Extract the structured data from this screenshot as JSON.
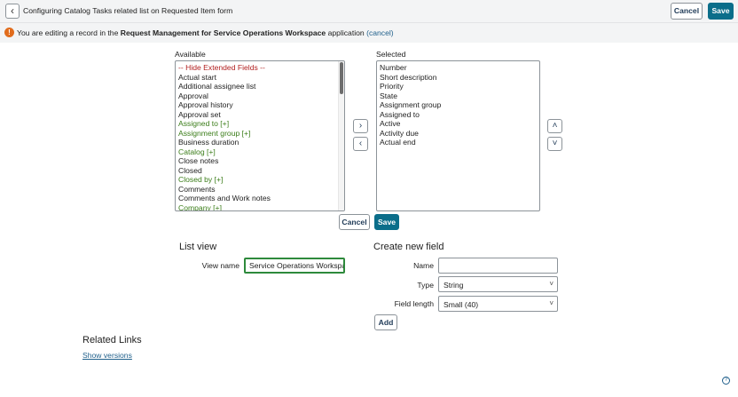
{
  "header": {
    "back_icon": "chevron-left-icon",
    "title": "Configuring Catalog Tasks related list on Requested Item form",
    "cancel_label": "Cancel",
    "save_label": "Save"
  },
  "notice": {
    "icon": "warning-icon",
    "prefix": "You are editing a record in the ",
    "app_name": "Request Management for Service Operations Workspace",
    "suffix": " application ",
    "link": "(cancel)"
  },
  "slushbucket": {
    "available_label": "Available",
    "selected_label": "Selected",
    "available_items": [
      {
        "label": "-- Hide Extended Fields --",
        "kind": "ext"
      },
      {
        "label": "Actual start",
        "kind": "plain"
      },
      {
        "label": "Additional assignee list",
        "kind": "plain"
      },
      {
        "label": "Approval",
        "kind": "plain"
      },
      {
        "label": "Approval history",
        "kind": "plain"
      },
      {
        "label": "Approval set",
        "kind": "plain"
      },
      {
        "label": "Assigned to [+]",
        "kind": "ref"
      },
      {
        "label": "Assignment group [+]",
        "kind": "ref"
      },
      {
        "label": "Business duration",
        "kind": "plain"
      },
      {
        "label": "Catalog [+]",
        "kind": "ref"
      },
      {
        "label": "Close notes",
        "kind": "plain"
      },
      {
        "label": "Closed",
        "kind": "plain"
      },
      {
        "label": "Closed by [+]",
        "kind": "ref"
      },
      {
        "label": "Comments",
        "kind": "plain"
      },
      {
        "label": "Comments and Work notes",
        "kind": "plain"
      },
      {
        "label": "Company [+]",
        "kind": "ref"
      }
    ],
    "selected_items": [
      "Number",
      "Short description",
      "Priority",
      "State",
      "Assignment group",
      "Assigned to",
      "Active",
      "Activity due",
      "Actual end"
    ],
    "add_icon": "chevron-right-icon",
    "remove_icon": "chevron-left-icon",
    "move_up_icon": "chevron-up-icon",
    "move_down_icon": "chevron-down-icon",
    "cancel_label": "Cancel",
    "save_label": "Save"
  },
  "list_view": {
    "title": "List view",
    "view_name_label": "View name",
    "view_name_value": "Service Operations Workspace"
  },
  "create_field": {
    "title": "Create new field",
    "name_label": "Name",
    "name_value": "",
    "type_label": "Type",
    "type_value": "String",
    "field_length_label": "Field length",
    "field_length_value": "Small (40)",
    "add_label": "Add"
  },
  "related_links": {
    "title": "Related Links",
    "show_versions": "Show versions"
  },
  "footer": {
    "help_icon": "help-icon"
  }
}
